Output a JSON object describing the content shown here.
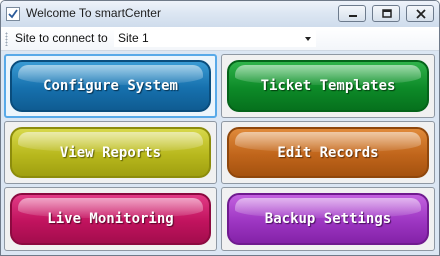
{
  "window": {
    "title": "Welcome To smartCenter",
    "app_icon": "checkmark-icon",
    "controls": [
      "minimize-icon",
      "maximize-icon",
      "close-icon"
    ]
  },
  "toolbar": {
    "site_label": "Site to connect to",
    "site_value": "Site 1"
  },
  "buttons": {
    "configure_system": "Configure System",
    "ticket_templates": "Ticket Templates",
    "view_reports": "View Reports",
    "edit_records": "Edit Records",
    "live_monitoring": "Live Monitoring",
    "backup_settings": "Backup Settings"
  },
  "colors": {
    "configure_system": "#1670ad",
    "ticket_templates": "#0d8a28",
    "view_reports": "#b8b81d",
    "edit_records": "#c0651b",
    "live_monitoring": "#c1135e",
    "backup_settings": "#9d36c2",
    "selected_panel_border": "#58a9e8"
  }
}
